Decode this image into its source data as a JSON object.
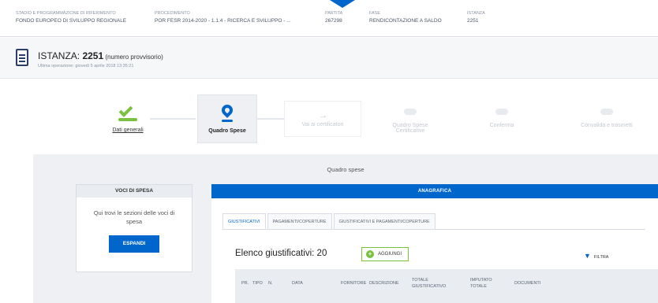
{
  "context": {
    "columns": [
      {
        "label": "Stadio e programmazione di riferimento",
        "value": "Fondo europeo di sviluppo regionale"
      },
      {
        "label": "Procedimento",
        "value": "POR FESR 2014-2020 - 1.1.4 - Ricerca e sviluppo - ..."
      },
      {
        "label": "Partita",
        "value": "267298"
      },
      {
        "label": "Fase",
        "value": "Rendicontazione a saldo"
      },
      {
        "label": "Istanza",
        "value": "2251"
      }
    ]
  },
  "header": {
    "title_prefix": "ISTANZA: ",
    "number": "2251",
    "title_suffix": " (numero provvisorio)",
    "meta": "Ultima operazione: giovedì 5 aprile 2018 13:35:21"
  },
  "steps": [
    {
      "label": "Dati generali",
      "state": "done"
    },
    {
      "label": "Quadro Spese",
      "state": "active"
    },
    {
      "label": "Vai ai certificatori",
      "state": "pending"
    },
    {
      "label": "Quadro Spese Certificative",
      "state": "pending"
    },
    {
      "label": "Conferma",
      "state": "pending"
    },
    {
      "label": "Convalida e trasmetti",
      "state": "pending"
    }
  ],
  "main": {
    "section_title": "Quadro spese",
    "voci": {
      "head": "VOCI DI SPESA",
      "text": "Qui trovi le sezioni delle voci di spesa",
      "button": "ESPANDI"
    },
    "anagrafica": {
      "head": "ANAGRAFICA",
      "tabs": [
        "GIUSTIFICATIVI",
        "PAGAMENTI/COPERTURE",
        "GIUSTIFICATIVI E PAGAMENTI/COPERTURE"
      ],
      "list_title": "Elenco giustificativi: 20",
      "add_label": "AGGIUNGI",
      "filter_label": "FILTRA",
      "columns": [
        "PR.",
        "TIPO",
        "N.",
        "DATA",
        "FORNITORE",
        "DESCRIZIONE",
        "TOTALE GIUSTIFICATIVO",
        "IMPUTATO TOTALE",
        "DOCUMENTI"
      ]
    }
  },
  "colors": {
    "accent": "#0066cc",
    "success": "#7ac142"
  }
}
